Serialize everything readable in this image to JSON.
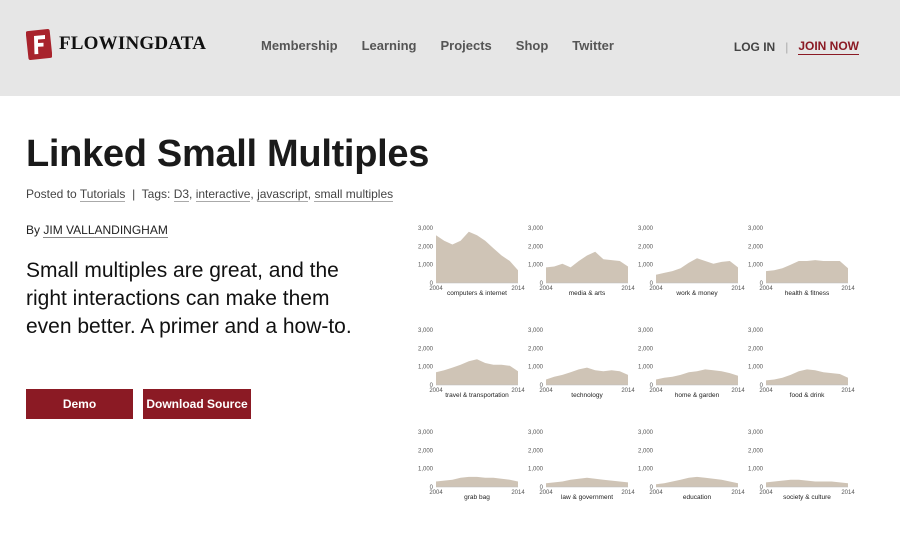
{
  "header": {
    "logo_text": "FLOWINGDATA",
    "nav": [
      "Membership",
      "Learning",
      "Projects",
      "Shop",
      "Twitter"
    ],
    "login": "LOG IN",
    "separator": "|",
    "join": "JOIN NOW"
  },
  "article": {
    "title": "Linked Small Multiples",
    "posted_prefix": "Posted to",
    "category": "Tutorials",
    "tags_sep": "|",
    "tags_prefix": "Tags:",
    "tags": [
      "D3",
      "interactive",
      "javascript",
      "small multiples"
    ],
    "by_prefix": "By",
    "author": "JIM VALLANDINGHAM",
    "lede": "Small multiples are great, and the right interactions can make them even better. A primer and a how-to.",
    "demo_label": "Demo",
    "download_label": "Download Source"
  },
  "colors": {
    "accent": "#8b1a24",
    "area_fill": "#cfc4b6",
    "header_bg": "#e6e6e6"
  },
  "chart_data": {
    "type": "area",
    "layout": "small multiples 4x3",
    "x": [
      2004,
      2005,
      2006,
      2007,
      2008,
      2009,
      2010,
      2011,
      2012,
      2013,
      2014
    ],
    "x_tick_labels": [
      "2004",
      "2014"
    ],
    "y_ticks": [
      "0",
      "1,000",
      "2,000",
      "3,000"
    ],
    "ylim": [
      0,
      3000
    ],
    "series": [
      {
        "name": "computers & internet",
        "values": [
          2600,
          2300,
          2100,
          2300,
          2800,
          2600,
          2300,
          1900,
          1500,
          1200,
          700
        ]
      },
      {
        "name": "media & arts",
        "values": [
          850,
          900,
          1050,
          850,
          1200,
          1500,
          1700,
          1300,
          1250,
          1200,
          900
        ]
      },
      {
        "name": "work & money",
        "values": [
          450,
          550,
          650,
          800,
          1100,
          1350,
          1200,
          1050,
          1150,
          1200,
          850
        ]
      },
      {
        "name": "health & fitness",
        "values": [
          650,
          700,
          800,
          1000,
          1200,
          1200,
          1250,
          1200,
          1200,
          1200,
          800
        ]
      },
      {
        "name": "travel & transportation",
        "values": [
          700,
          800,
          950,
          1100,
          1300,
          1400,
          1200,
          1100,
          1100,
          1050,
          750
        ]
      },
      {
        "name": "technology",
        "values": [
          300,
          450,
          550,
          700,
          850,
          950,
          800,
          750,
          800,
          750,
          550
        ]
      },
      {
        "name": "home & garden",
        "values": [
          300,
          400,
          450,
          550,
          700,
          750,
          850,
          800,
          750,
          650,
          500
        ]
      },
      {
        "name": "food & drink",
        "values": [
          250,
          300,
          400,
          550,
          750,
          850,
          800,
          700,
          650,
          600,
          400
        ]
      },
      {
        "name": "grab bag",
        "values": [
          300,
          350,
          400,
          500,
          550,
          550,
          500,
          500,
          450,
          400,
          300
        ]
      },
      {
        "name": "law & government",
        "values": [
          200,
          250,
          300,
          400,
          450,
          500,
          450,
          400,
          350,
          300,
          250
        ]
      },
      {
        "name": "education",
        "values": [
          150,
          200,
          300,
          400,
          500,
          550,
          500,
          450,
          400,
          300,
          200
        ]
      },
      {
        "name": "society & culture",
        "values": [
          250,
          300,
          350,
          400,
          400,
          350,
          300,
          300,
          300,
          250,
          200
        ]
      }
    ]
  }
}
